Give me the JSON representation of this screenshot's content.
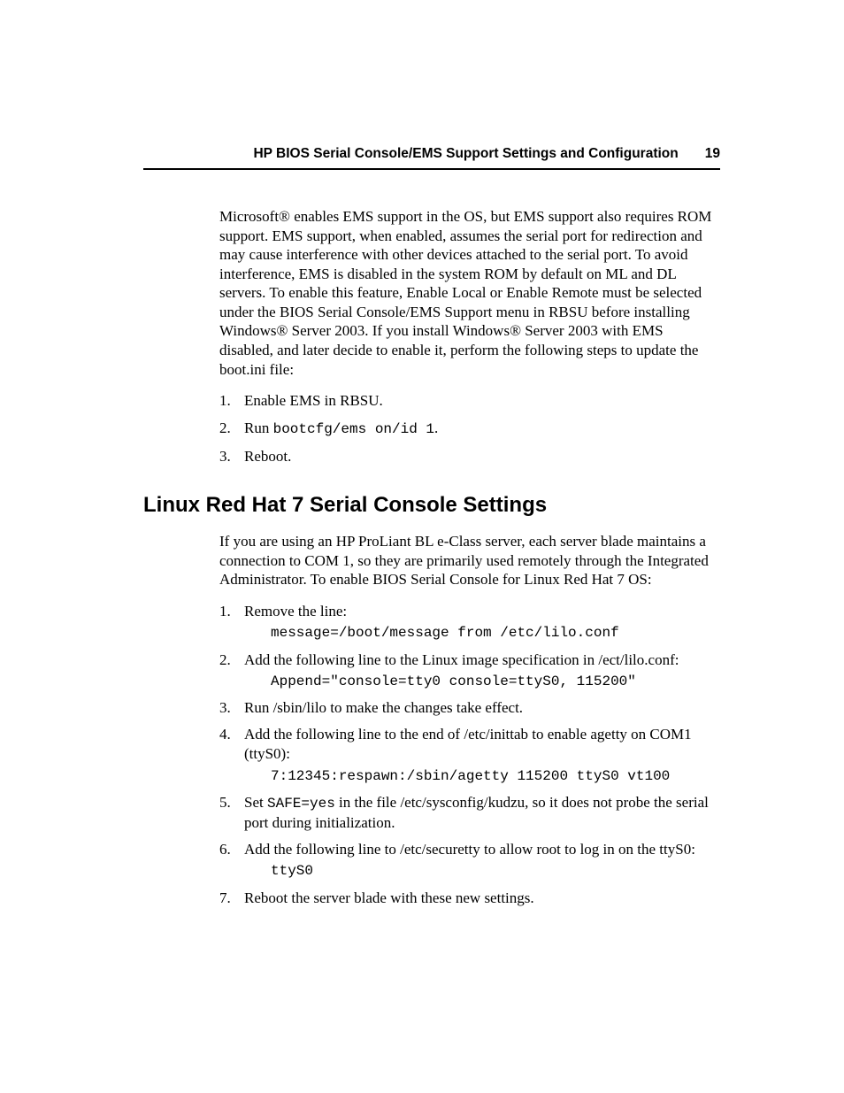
{
  "header": {
    "title": "HP BIOS Serial Console/EMS Support Settings and Configuration",
    "page": "19"
  },
  "intro_para": "Microsoft® enables EMS support in the OS, but EMS support also requires ROM support. EMS support, when enabled, assumes the serial port for redirection and may cause interference with other devices attached to the serial port. To avoid interference, EMS is disabled in the system ROM by default on ML and DL servers. To enable this feature, Enable Local or Enable Remote must be selected under the BIOS Serial Console/EMS Support menu in RBSU before installing Windows® Server 2003. If you install Windows® Server 2003 with EMS disabled, and later decide to enable it, perform the following steps to update the boot.ini file:",
  "steps1": {
    "s1": "Enable EMS in RBSU.",
    "s2_a": "Run ",
    "s2_b": "bootcfg/ems on/id 1",
    "s2_c": ".",
    "s3": "Reboot."
  },
  "section_heading": "Linux Red Hat 7 Serial Console Settings",
  "section_para": "If you are using an HP ProLiant BL e-Class server, each server blade maintains a connection to COM 1, so they are primarily used remotely through the Integrated Administrator. To enable BIOS Serial Console for Linux Red Hat 7 OS:",
  "steps2": {
    "s1_text": "Remove the line:",
    "s1_code": "message=/boot/message from /etc/lilo.conf",
    "s2_text": "Add the following line to the Linux image specification in /ect/lilo.conf:",
    "s2_code": "Append=\"console=tty0 console=ttyS0, 115200\"",
    "s3_text": "Run /sbin/lilo to make the changes take effect.",
    "s4_text": "Add the following line to the end of /etc/inittab to enable agetty on COM1 (ttyS0):",
    "s4_code": "7:12345:respawn:/sbin/agetty 115200 ttyS0 vt100",
    "s5_a": "Set ",
    "s5_b": "SAFE=yes",
    "s5_c": " in the file /etc/sysconfig/kudzu, so it does not probe the serial port during initialization.",
    "s6_text": "Add the following line to /etc/securetty to allow root to log in on the ttyS0:",
    "s6_code": "ttyS0",
    "s7_text": "Reboot the server blade with these new settings."
  }
}
